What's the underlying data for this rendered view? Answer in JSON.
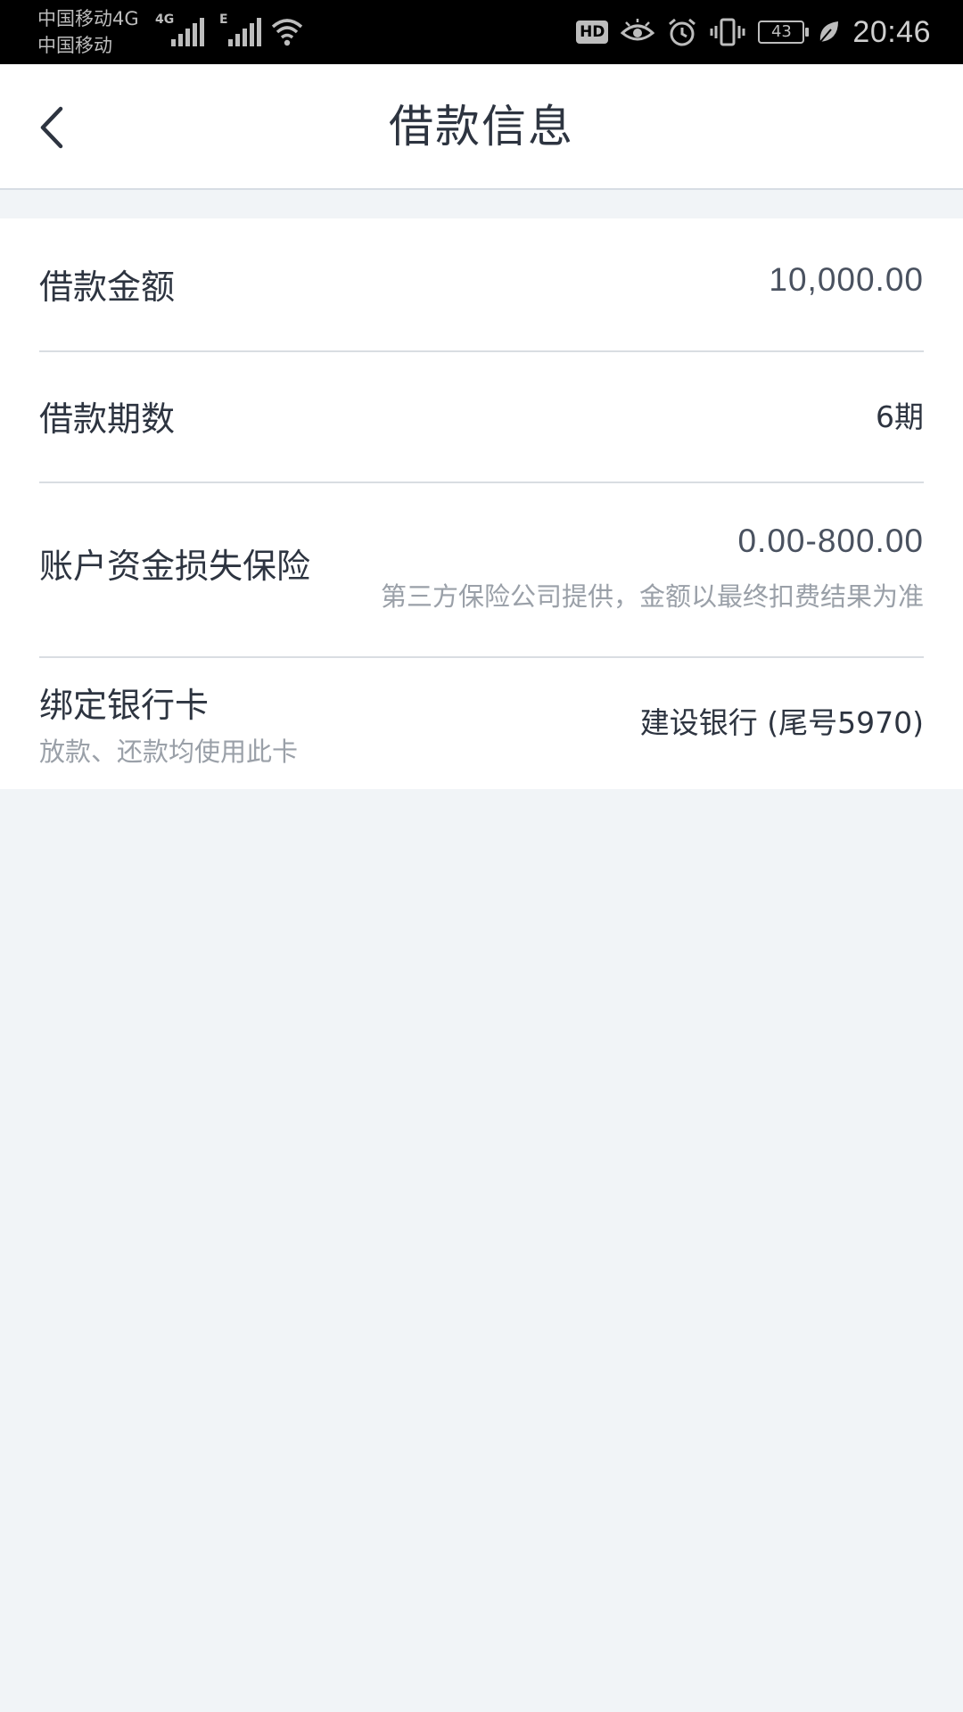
{
  "status_bar": {
    "carrier_1": "中国移动4G",
    "carrier_2": "中国移动",
    "sim1_tag": "4G",
    "sim2_tag": "E",
    "hd_label": "HD",
    "battery_level": "43",
    "time": "20:46",
    "icons": [
      "signal-icon",
      "wifi-icon",
      "eye-icon",
      "alarm-icon",
      "vibrate-icon",
      "battery-icon",
      "leaf-icon"
    ]
  },
  "nav": {
    "title": "借款信息",
    "back_icon": "chevron-left-icon"
  },
  "rows": [
    {
      "label": "借款金额",
      "value": "10,000.00"
    },
    {
      "label": "借款期数",
      "value": "6期"
    },
    {
      "label": "账户资金损失保险",
      "value": "0.00-800.00",
      "sub": "第三方保险公司提供，金额以最终扣费结果为准"
    },
    {
      "label": "绑定银行卡",
      "sub": "放款、还款均使用此卡",
      "value": "建设银行 (尾号5970)"
    }
  ]
}
